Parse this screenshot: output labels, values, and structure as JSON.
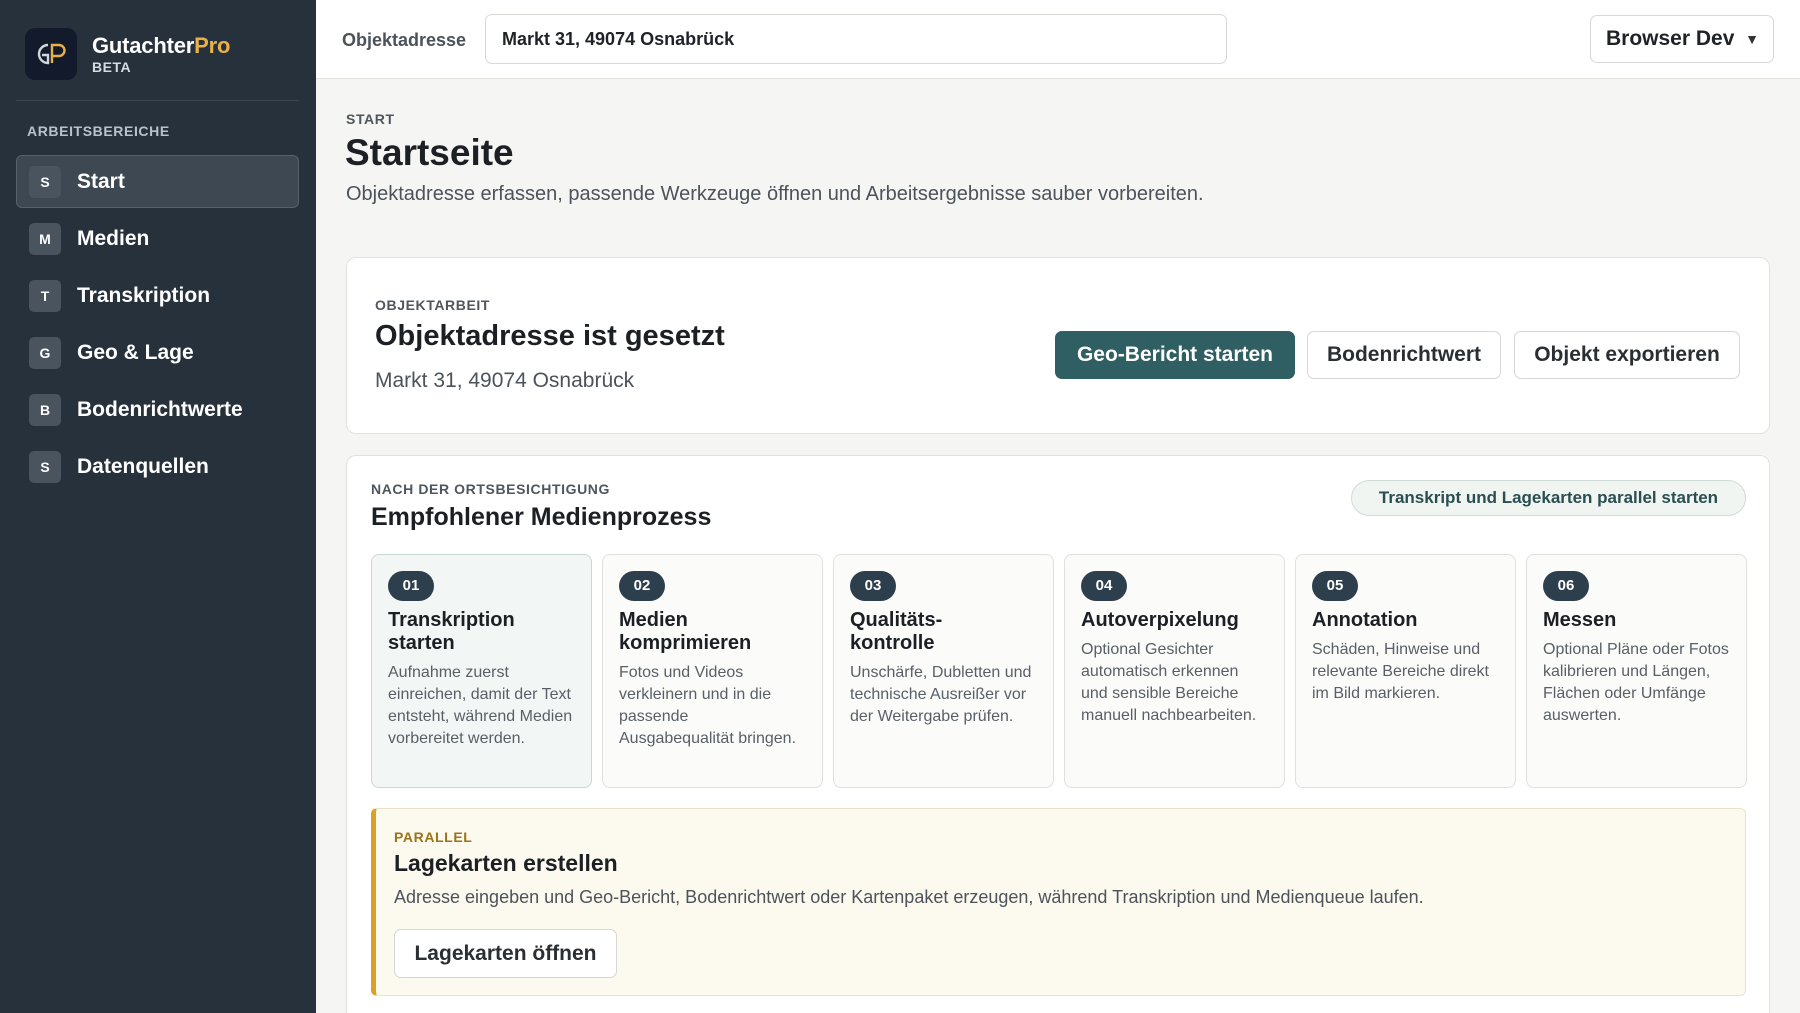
{
  "sidebar": {
    "brand_name": "Gutachter",
    "brand_name_accent": "Pro",
    "brand_sub": "BETA",
    "section_label": "ARBEITSBEREICHE",
    "items": [
      {
        "badge": "S",
        "label": "Start",
        "active": true
      },
      {
        "badge": "M",
        "label": "Medien"
      },
      {
        "badge": "T",
        "label": "Transkription"
      },
      {
        "badge": "G",
        "label": "Geo & Lage"
      },
      {
        "badge": "B",
        "label": "Bodenrichtwerte"
      },
      {
        "badge": "S",
        "label": "Datenquellen"
      }
    ]
  },
  "topbar": {
    "address_label": "Objektadresse",
    "address_value": "Markt 31, 49074 Osnabrück",
    "env_select": "Browser Dev"
  },
  "page": {
    "breadcrumb": "START",
    "title": "Startseite",
    "description": "Objektadresse erfassen, passende Werkzeuge öffnen und Arbeitsergebnisse sauber vorbereiten."
  },
  "object_card": {
    "eyebrow": "OBJEKTARBEIT",
    "title": "Objektadresse ist gesetzt",
    "address": "Markt 31, 49074 Osnabrück",
    "buttons": {
      "geo": "Geo-Bericht starten",
      "boden": "Bodenrichtwert",
      "export": "Objekt exportieren"
    }
  },
  "media_process": {
    "eyebrow": "NACH DER ORTSBESICHTIGUNG",
    "title": "Empfohlener Medienprozess",
    "parallel_button": "Transkript und Lagekarten parallel starten",
    "steps": [
      {
        "num": "01",
        "title": "Transkription\nstarten",
        "desc": "Aufnahme zuerst einreichen, damit der Text entsteht, während Medien vorbereitet werden."
      },
      {
        "num": "02",
        "title": "Medien\nkomprimieren",
        "desc": "Fotos und Videos verkleinern und in die passende Ausgabequalität bringen."
      },
      {
        "num": "03",
        "title": "Qualitäts-\nkontrolle",
        "desc": "Unschärfe, Dubletten und technische Ausreißer vor der Weitergabe prüfen."
      },
      {
        "num": "04",
        "title": "Autoverpixelung",
        "desc": "Optional Gesichter automatisch erkennen und sensible Bereiche manuell nachbearbeiten."
      },
      {
        "num": "05",
        "title": "Annotation",
        "desc": "Schäden, Hinweise und relevante Bereiche direkt im Bild markieren."
      },
      {
        "num": "06",
        "title": "Messen",
        "desc": "Optional Pläne oder Fotos kalibrieren und Längen, Flächen oder Umfänge auswerten."
      }
    ],
    "parallel": {
      "eyebrow": "PARALLEL",
      "title": "Lagekarten erstellen",
      "desc": "Adresse eingeben und Geo-Bericht, Bodenrichtwert oder Kartenpaket erzeugen, während Transkription und Medienqueue laufen.",
      "button": "Lagekarten öffnen"
    }
  },
  "colors": {
    "sidebar_bg": "#27313c",
    "accent": "#e8b04a",
    "primary_button": "#2f5e63",
    "parallel_border": "#d9a227"
  }
}
